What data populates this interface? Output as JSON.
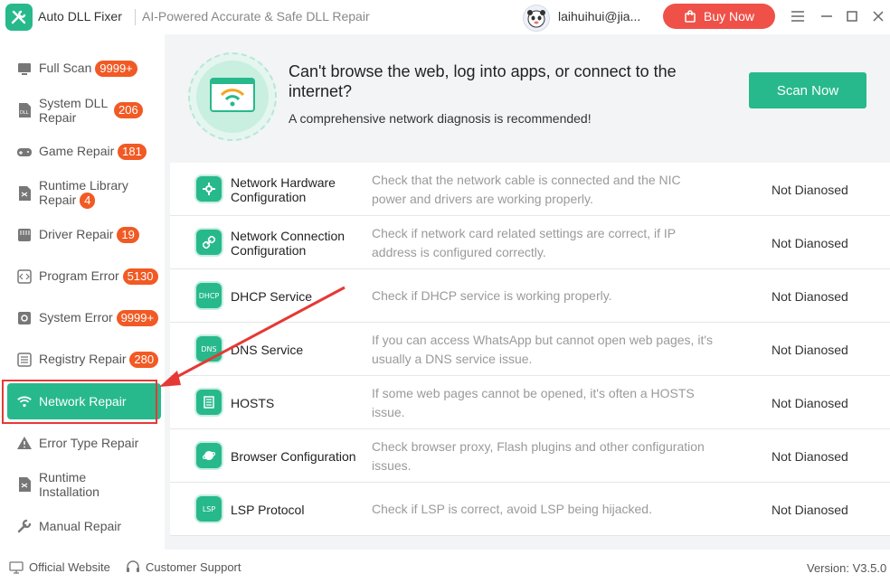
{
  "app": {
    "name": "Auto DLL Fixer",
    "tagline": "AI-Powered Accurate & Safe DLL Repair",
    "user": "laihuihui@jia...",
    "buy_label": "Buy Now",
    "accent": "#27b98b",
    "buy_color": "#ef5149",
    "badge_color": "#f15a24"
  },
  "sidebar": {
    "items": [
      {
        "label": "Full Scan",
        "badge": "9999+",
        "icon": "monitor-icon"
      },
      {
        "label": "System DLL",
        "label2": "Repair",
        "badge": "206",
        "icon": "dll-file-icon"
      },
      {
        "label": "Game Repair",
        "badge": "181",
        "icon": "gamepad-icon"
      },
      {
        "label": "Runtime Library",
        "label2": "Repair",
        "badge": "4",
        "icon": "runtime-library-icon"
      },
      {
        "label": "Driver Repair",
        "badge": "19",
        "icon": "driver-icon"
      },
      {
        "label": "Program Error",
        "badge": "5130",
        "icon": "code-icon"
      },
      {
        "label": "System Error",
        "badge": "9999+",
        "icon": "gear-icon"
      },
      {
        "label": "Registry Repair",
        "badge": "280",
        "icon": "registry-icon"
      },
      {
        "label": "Network Repair",
        "badge": "",
        "icon": "wifi-icon",
        "active": true
      },
      {
        "label": "Error Type Repair",
        "badge": "",
        "icon": "warning-icon"
      },
      {
        "label": "Runtime",
        "label2": "Installation",
        "badge": "",
        "icon": "runtime-install-icon"
      },
      {
        "label": "Manual Repair",
        "badge": "",
        "icon": "wrench-icon"
      }
    ]
  },
  "banner": {
    "title": "Can't browse the web, log into apps, or connect to the internet?",
    "subtitle": "A comprehensive network diagnosis is recommended!",
    "scan_label": "Scan Now"
  },
  "checks": [
    {
      "name": "Network Hardware Configuration",
      "desc": "Check that the network cable is connected and the NIC power and drivers are working properly.",
      "status": "Not Dianosed",
      "icon": "gear-icon",
      "icon_text": ""
    },
    {
      "name": "Network Connection Configuration",
      "desc": "Check if network card related settings are correct, if IP address is configured correctly.",
      "status": "Not Dianosed",
      "icon": "link-icon",
      "icon_text": ""
    },
    {
      "name": "DHCP Service",
      "desc": "Check if DHCP service is working properly.",
      "status": "Not Dianosed",
      "icon": "dhcp-icon",
      "icon_text": "DHCP"
    },
    {
      "name": "DNS Service",
      "desc": "If you can access WhatsApp but cannot open web pages, it's usually a DNS service issue.",
      "status": "Not Dianosed",
      "icon": "dns-icon",
      "icon_text": "DNS"
    },
    {
      "name": "HOSTS",
      "desc": "If some web pages cannot be opened, it's often a HOSTS issue.",
      "status": "Not Dianosed",
      "icon": "hosts-icon",
      "icon_text": ""
    },
    {
      "name": "Browser Configuration",
      "desc": "Check browser proxy, Flash plugins and other configuration issues.",
      "status": "Not Dianosed",
      "icon": "browser-icon",
      "icon_text": ""
    },
    {
      "name": "LSP Protocol",
      "desc": "Check if LSP is correct, avoid LSP being hijacked.",
      "status": "Not Dianosed",
      "icon": "lsp-icon",
      "icon_text": "LSP"
    }
  ],
  "footer": {
    "website": "Official Website",
    "support": "Customer Support",
    "version": "Version: V3.5.0"
  }
}
